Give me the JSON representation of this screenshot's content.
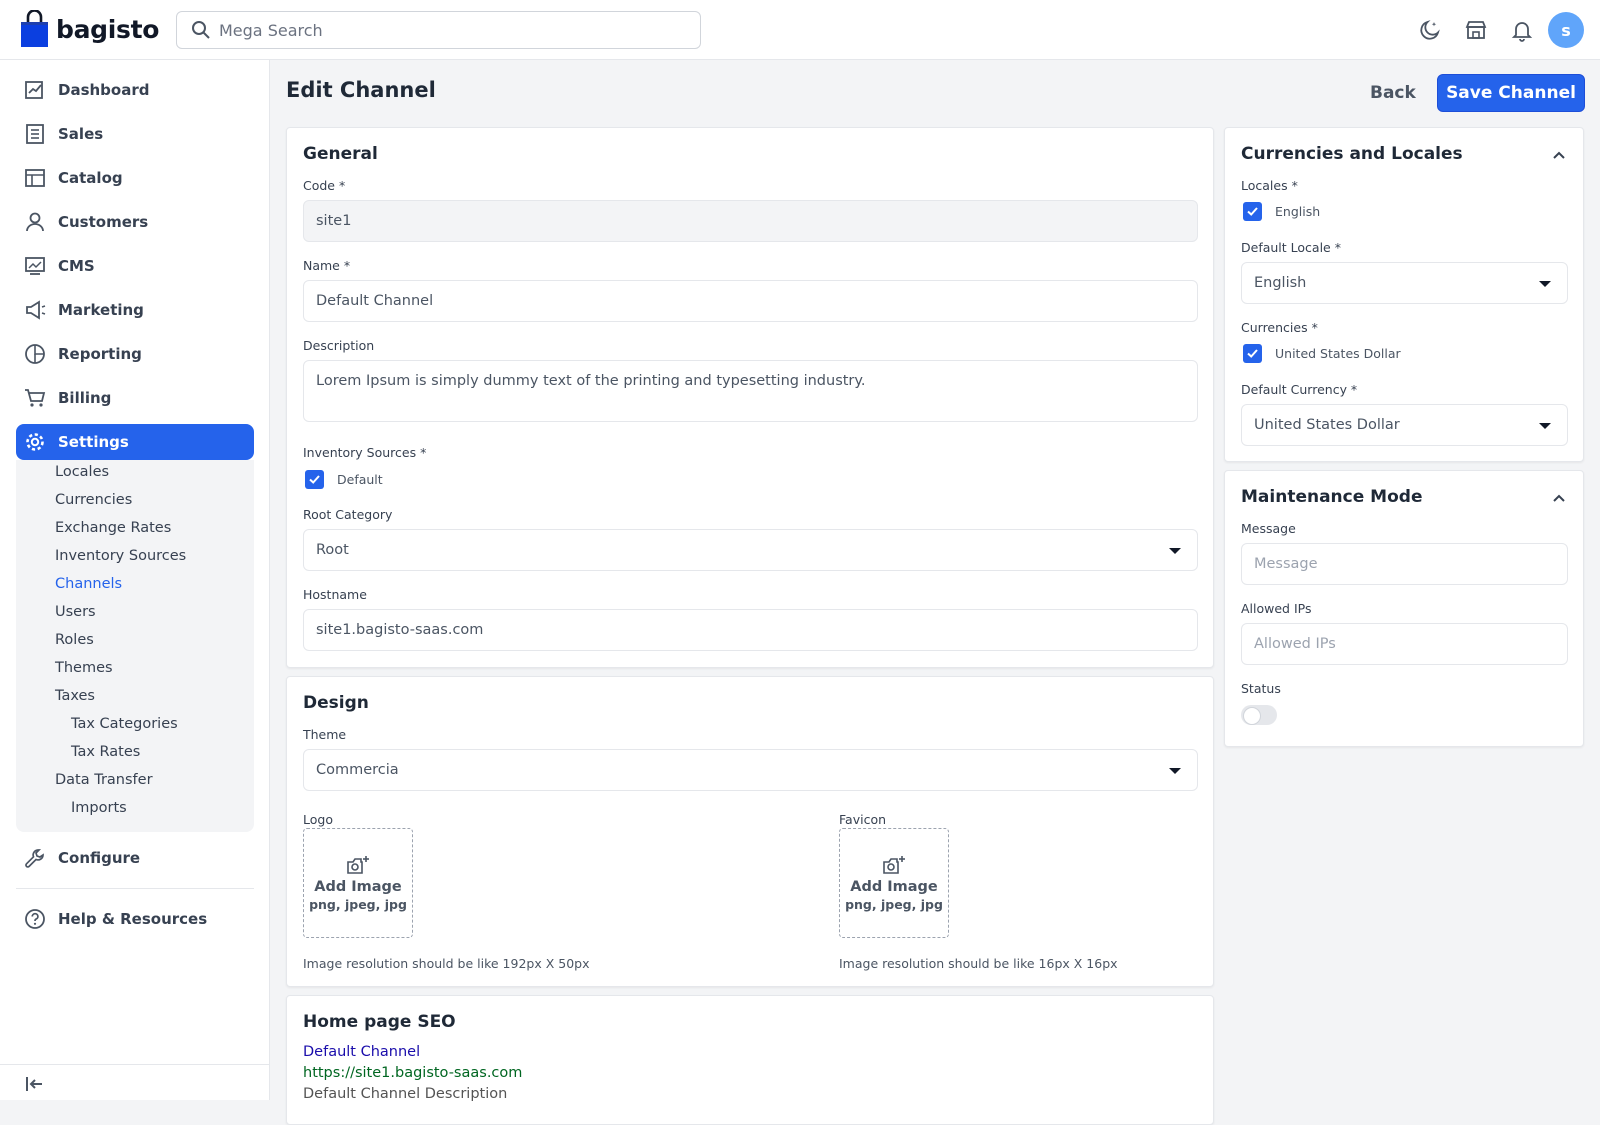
{
  "header": {
    "brand": "bagisto",
    "search_placeholder": "Mega Search",
    "avatar_letter": "s",
    "icons": [
      "theme-toggle-icon",
      "storefront-icon",
      "notification-bell-icon"
    ]
  },
  "sidebar": {
    "items": [
      {
        "label": "Dashboard",
        "icon": "dashboard-icon"
      },
      {
        "label": "Sales",
        "icon": "sales-icon"
      },
      {
        "label": "Catalog",
        "icon": "catalog-icon"
      },
      {
        "label": "Customers",
        "icon": "customers-icon"
      },
      {
        "label": "CMS",
        "icon": "cms-icon"
      },
      {
        "label": "Marketing",
        "icon": "marketing-icon"
      },
      {
        "label": "Reporting",
        "icon": "reporting-icon"
      },
      {
        "label": "Billing",
        "icon": "billing-icon"
      },
      {
        "label": "Settings",
        "icon": "settings-icon",
        "active": true
      }
    ],
    "settings_children": [
      "Locales",
      "Currencies",
      "Exchange Rates",
      "Inventory Sources",
      "Channels",
      "Users",
      "Roles",
      "Themes",
      "Taxes",
      "Tax Categories",
      "Tax Rates",
      "Data Transfer",
      "Imports"
    ],
    "active_child": "Channels",
    "configure": "Configure",
    "help": "Help & Resources"
  },
  "page": {
    "title": "Edit Channel",
    "back": "Back",
    "save": "Save Channel"
  },
  "general": {
    "title": "General",
    "code_label": "Code *",
    "code_value": "site1",
    "name_label": "Name *",
    "name_value": "Default Channel",
    "description_label": "Description",
    "description_value": "Lorem Ipsum is simply dummy text of the printing and typesetting industry.",
    "inventory_label": "Inventory Sources *",
    "inventory_option": "Default",
    "root_category_label": "Root Category",
    "root_category_value": "Root",
    "hostname_label": "Hostname",
    "hostname_value": "site1.bagisto-saas.com"
  },
  "design": {
    "title": "Design",
    "theme_label": "Theme",
    "theme_value": "Commercia",
    "logo_label": "Logo",
    "favicon_label": "Favicon",
    "add_image": "Add Image",
    "formats": "png, jpeg, jpg",
    "logo_hint": "Image resolution should be like 192px X 50px",
    "favicon_hint": "Image resolution should be like 16px X 16px"
  },
  "seo": {
    "title": "Home page SEO",
    "preview_title": "Default Channel",
    "preview_url": "https://site1.bagisto-saas.com",
    "preview_description": "Default Channel Description"
  },
  "currencies_locales": {
    "title": "Currencies and Locales",
    "locales_label": "Locales *",
    "locale_option": "English",
    "default_locale_label": "Default Locale *",
    "default_locale_value": "English",
    "currencies_label": "Currencies *",
    "currency_option": "United States Dollar",
    "default_currency_label": "Default Currency *",
    "default_currency_value": "United States Dollar"
  },
  "maintenance": {
    "title": "Maintenance Mode",
    "message_label": "Message",
    "message_placeholder": "Message",
    "allowed_ips_label": "Allowed IPs",
    "allowed_ips_placeholder": "Allowed IPs",
    "status_label": "Status",
    "status_on": false
  },
  "colors": {
    "accent": "#2563eb",
    "avatar": "#60a5fa"
  }
}
